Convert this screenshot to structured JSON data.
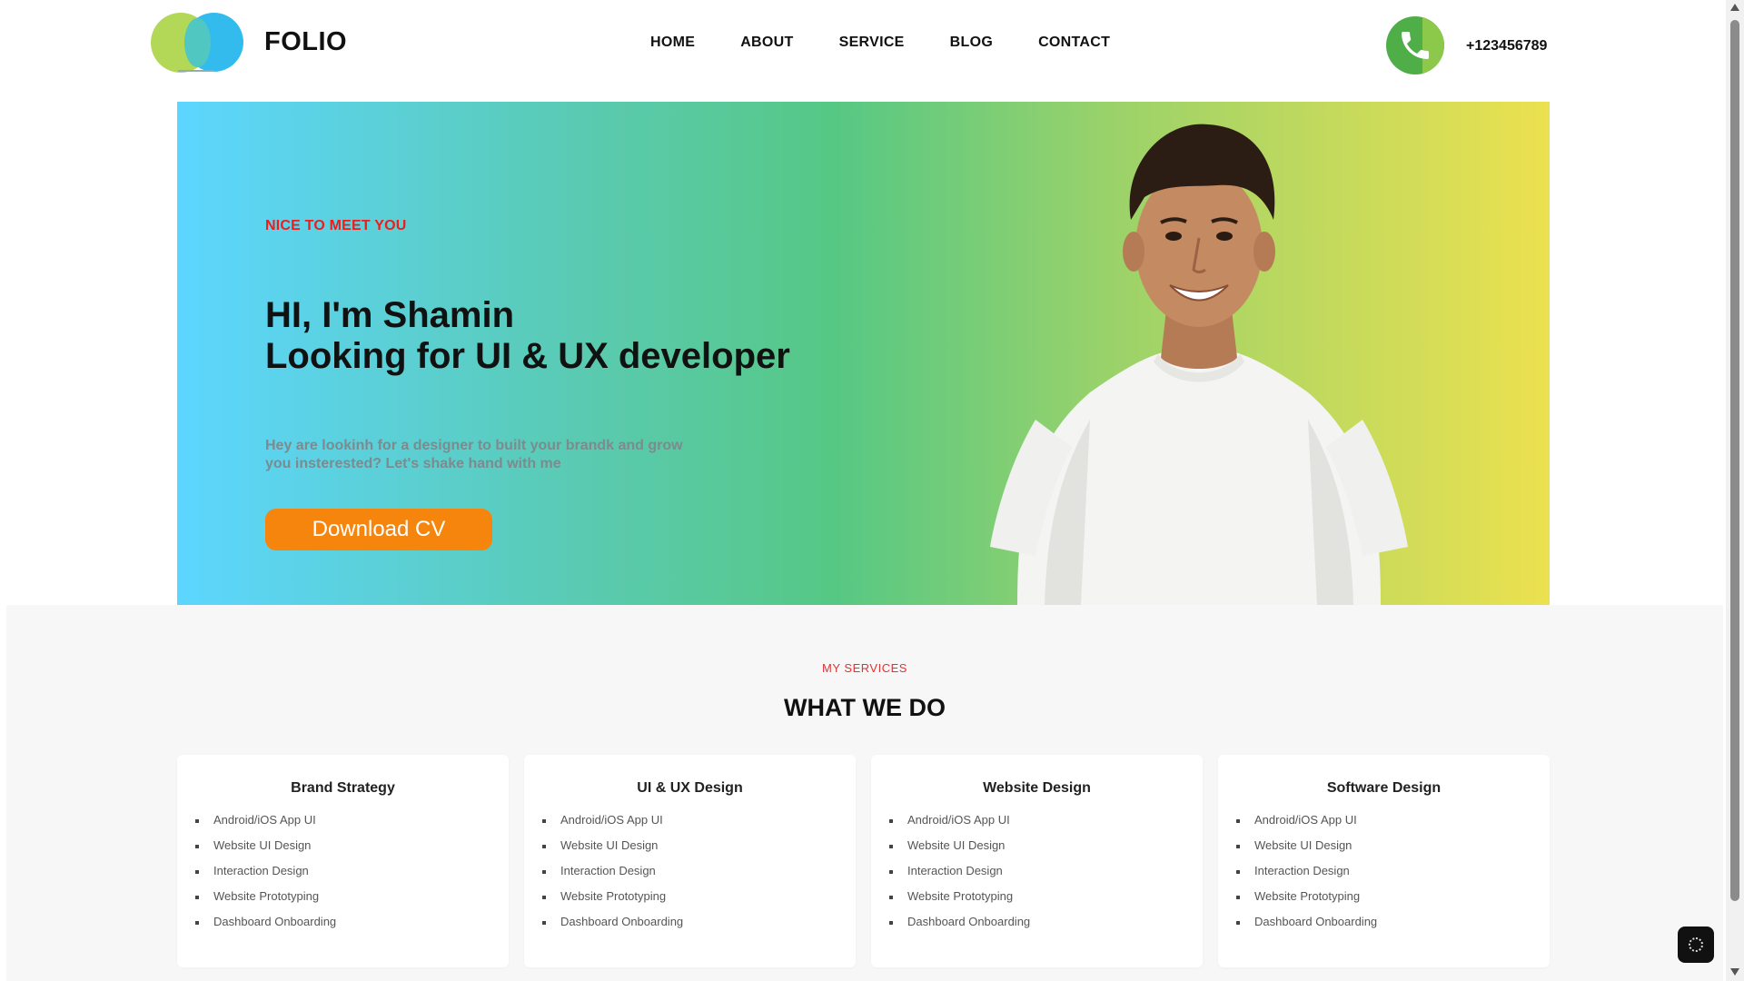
{
  "header": {
    "brand": "FOLIO",
    "nav": [
      "HOME",
      "ABOUT",
      "SERVICE",
      "BLOG",
      "CONTACT"
    ],
    "phone": "+123456789"
  },
  "hero": {
    "kicker": "NICE TO MEET YOU",
    "title_line1": "HI, I'm Shamin",
    "title_line2": "Looking for UI & UX developer",
    "desc_line1": "Hey are lookinh for a designer to built your brandk and grow",
    "desc_line2": "you insterested? Let's shake hand with me",
    "cta": "Download CV"
  },
  "services": {
    "kicker": "MY SERVICES",
    "title": "WHAT WE DO",
    "cards": [
      {
        "title": "Brand Strategy",
        "items": [
          "Android/iOS App UI",
          "Website UI Design",
          "Interaction Design",
          "Website Prototyping",
          "Dashboard Onboarding"
        ]
      },
      {
        "title": "UI & UX Design",
        "items": [
          "Android/iOS App UI",
          "Website UI Design",
          "Interaction Design",
          "Website Prototyping",
          "Dashboard Onboarding"
        ]
      },
      {
        "title": "Website Design",
        "items": [
          "Android/iOS App UI",
          "Website UI Design",
          "Interaction Design",
          "Website Prototyping",
          "Dashboard Onboarding"
        ]
      },
      {
        "title": "Software Design",
        "items": [
          "Android/iOS App UI",
          "Website UI Design",
          "Interaction Design",
          "Website Prototyping",
          "Dashboard Onboarding"
        ]
      }
    ]
  },
  "colors": {
    "accent_red": "#ee1c1c",
    "cta_orange": "#f5850c",
    "phone_green": "#4fae47"
  },
  "icons": {
    "logo": "two-circles-logo",
    "phone": "phone-icon",
    "widget": "floating-widget-icon"
  }
}
